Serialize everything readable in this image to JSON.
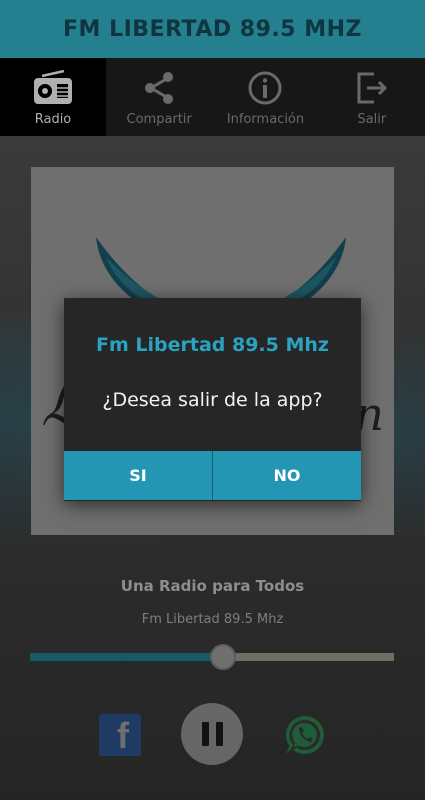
{
  "app": {
    "title": "FM LIBERTAD 89.5 MHZ"
  },
  "tabs": [
    {
      "label": "Radio",
      "icon": "radio-icon",
      "active": true
    },
    {
      "label": "Compartir",
      "icon": "share-icon",
      "active": false
    },
    {
      "label": "Información",
      "icon": "info-icon",
      "active": false
    },
    {
      "label": "Salir",
      "icon": "exit-icon",
      "active": false
    }
  ],
  "player": {
    "title": "Una Radio para Todos",
    "subtitle": "Fm Libertad 89.5 Mhz",
    "progress": 0.53
  },
  "social": {
    "facebook_icon": "facebook-icon",
    "pause_icon": "pause-icon",
    "whatsapp_icon": "whatsapp-icon"
  },
  "dialog": {
    "title": "Fm Libertad 89.5 Mhz",
    "message": "¿Desea salir de la app?",
    "yes_label": "SI",
    "no_label": "NO"
  },
  "colors": {
    "accent": "#2296b2",
    "title_bar": "#24808e",
    "dialog_title": "#2aa3c0"
  }
}
